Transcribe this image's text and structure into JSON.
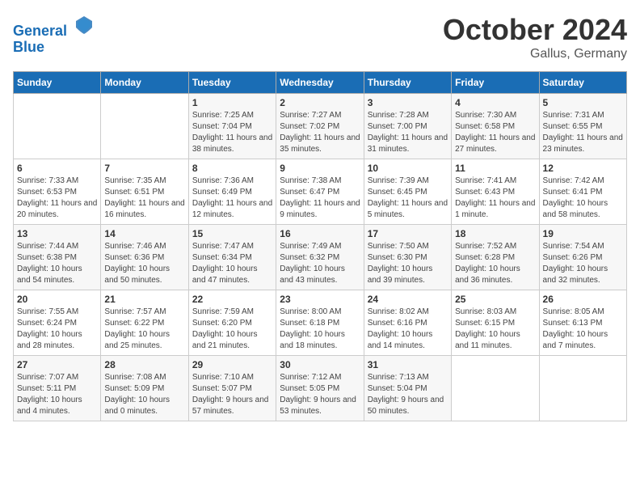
{
  "header": {
    "logo_line1": "General",
    "logo_line2": "Blue",
    "month": "October 2024",
    "location": "Gallus, Germany"
  },
  "weekdays": [
    "Sunday",
    "Monday",
    "Tuesday",
    "Wednesday",
    "Thursday",
    "Friday",
    "Saturday"
  ],
  "weeks": [
    [
      {
        "day": "",
        "info": ""
      },
      {
        "day": "",
        "info": ""
      },
      {
        "day": "1",
        "info": "Sunrise: 7:25 AM\nSunset: 7:04 PM\nDaylight: 11 hours and 38 minutes."
      },
      {
        "day": "2",
        "info": "Sunrise: 7:27 AM\nSunset: 7:02 PM\nDaylight: 11 hours and 35 minutes."
      },
      {
        "day": "3",
        "info": "Sunrise: 7:28 AM\nSunset: 7:00 PM\nDaylight: 11 hours and 31 minutes."
      },
      {
        "day": "4",
        "info": "Sunrise: 7:30 AM\nSunset: 6:58 PM\nDaylight: 11 hours and 27 minutes."
      },
      {
        "day": "5",
        "info": "Sunrise: 7:31 AM\nSunset: 6:55 PM\nDaylight: 11 hours and 23 minutes."
      }
    ],
    [
      {
        "day": "6",
        "info": "Sunrise: 7:33 AM\nSunset: 6:53 PM\nDaylight: 11 hours and 20 minutes."
      },
      {
        "day": "7",
        "info": "Sunrise: 7:35 AM\nSunset: 6:51 PM\nDaylight: 11 hours and 16 minutes."
      },
      {
        "day": "8",
        "info": "Sunrise: 7:36 AM\nSunset: 6:49 PM\nDaylight: 11 hours and 12 minutes."
      },
      {
        "day": "9",
        "info": "Sunrise: 7:38 AM\nSunset: 6:47 PM\nDaylight: 11 hours and 9 minutes."
      },
      {
        "day": "10",
        "info": "Sunrise: 7:39 AM\nSunset: 6:45 PM\nDaylight: 11 hours and 5 minutes."
      },
      {
        "day": "11",
        "info": "Sunrise: 7:41 AM\nSunset: 6:43 PM\nDaylight: 11 hours and 1 minute."
      },
      {
        "day": "12",
        "info": "Sunrise: 7:42 AM\nSunset: 6:41 PM\nDaylight: 10 hours and 58 minutes."
      }
    ],
    [
      {
        "day": "13",
        "info": "Sunrise: 7:44 AM\nSunset: 6:38 PM\nDaylight: 10 hours and 54 minutes."
      },
      {
        "day": "14",
        "info": "Sunrise: 7:46 AM\nSunset: 6:36 PM\nDaylight: 10 hours and 50 minutes."
      },
      {
        "day": "15",
        "info": "Sunrise: 7:47 AM\nSunset: 6:34 PM\nDaylight: 10 hours and 47 minutes."
      },
      {
        "day": "16",
        "info": "Sunrise: 7:49 AM\nSunset: 6:32 PM\nDaylight: 10 hours and 43 minutes."
      },
      {
        "day": "17",
        "info": "Sunrise: 7:50 AM\nSunset: 6:30 PM\nDaylight: 10 hours and 39 minutes."
      },
      {
        "day": "18",
        "info": "Sunrise: 7:52 AM\nSunset: 6:28 PM\nDaylight: 10 hours and 36 minutes."
      },
      {
        "day": "19",
        "info": "Sunrise: 7:54 AM\nSunset: 6:26 PM\nDaylight: 10 hours and 32 minutes."
      }
    ],
    [
      {
        "day": "20",
        "info": "Sunrise: 7:55 AM\nSunset: 6:24 PM\nDaylight: 10 hours and 28 minutes."
      },
      {
        "day": "21",
        "info": "Sunrise: 7:57 AM\nSunset: 6:22 PM\nDaylight: 10 hours and 25 minutes."
      },
      {
        "day": "22",
        "info": "Sunrise: 7:59 AM\nSunset: 6:20 PM\nDaylight: 10 hours and 21 minutes."
      },
      {
        "day": "23",
        "info": "Sunrise: 8:00 AM\nSunset: 6:18 PM\nDaylight: 10 hours and 18 minutes."
      },
      {
        "day": "24",
        "info": "Sunrise: 8:02 AM\nSunset: 6:16 PM\nDaylight: 10 hours and 14 minutes."
      },
      {
        "day": "25",
        "info": "Sunrise: 8:03 AM\nSunset: 6:15 PM\nDaylight: 10 hours and 11 minutes."
      },
      {
        "day": "26",
        "info": "Sunrise: 8:05 AM\nSunset: 6:13 PM\nDaylight: 10 hours and 7 minutes."
      }
    ],
    [
      {
        "day": "27",
        "info": "Sunrise: 7:07 AM\nSunset: 5:11 PM\nDaylight: 10 hours and 4 minutes."
      },
      {
        "day": "28",
        "info": "Sunrise: 7:08 AM\nSunset: 5:09 PM\nDaylight: 10 hours and 0 minutes."
      },
      {
        "day": "29",
        "info": "Sunrise: 7:10 AM\nSunset: 5:07 PM\nDaylight: 9 hours and 57 minutes."
      },
      {
        "day": "30",
        "info": "Sunrise: 7:12 AM\nSunset: 5:05 PM\nDaylight: 9 hours and 53 minutes."
      },
      {
        "day": "31",
        "info": "Sunrise: 7:13 AM\nSunset: 5:04 PM\nDaylight: 9 hours and 50 minutes."
      },
      {
        "day": "",
        "info": ""
      },
      {
        "day": "",
        "info": ""
      }
    ]
  ]
}
